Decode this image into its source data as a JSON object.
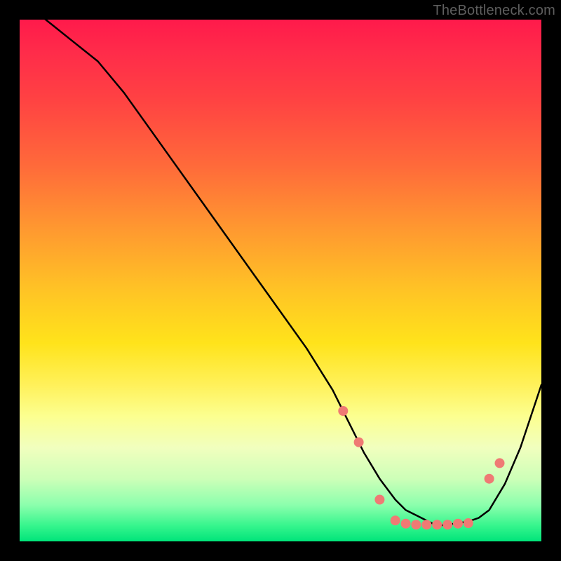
{
  "watermark": "TheBottleneck.com",
  "colors": {
    "line": "#000000",
    "dot": "#ef7a74",
    "background": "#000000"
  },
  "chart_data": {
    "type": "line",
    "title": "",
    "xlabel": "",
    "ylabel": "",
    "xlim": [
      0,
      100
    ],
    "ylim": [
      0,
      100
    ],
    "grid": false,
    "legend": false,
    "series": [
      {
        "name": "curve",
        "x": [
          0,
          5,
          10,
          15,
          20,
          25,
          30,
          35,
          40,
          45,
          50,
          55,
          60,
          63,
          66,
          69,
          72,
          74,
          76,
          78,
          80,
          82,
          84,
          86,
          88,
          90,
          93,
          96,
          100
        ],
        "y": [
          104,
          100,
          96,
          92,
          86,
          79,
          72,
          65,
          58,
          51,
          44,
          37,
          29,
          23,
          17,
          12,
          8,
          6,
          5,
          4,
          3,
          3.2,
          3.5,
          3.8,
          4.5,
          6,
          11,
          18,
          30
        ]
      }
    ],
    "markers": {
      "name": "dots",
      "x": [
        62,
        65,
        69,
        72,
        74,
        76,
        78,
        80,
        82,
        84,
        86,
        90,
        92
      ],
      "y": [
        25,
        19,
        8,
        4.0,
        3.4,
        3.2,
        3.2,
        3.2,
        3.2,
        3.4,
        3.5,
        12,
        15
      ]
    }
  }
}
